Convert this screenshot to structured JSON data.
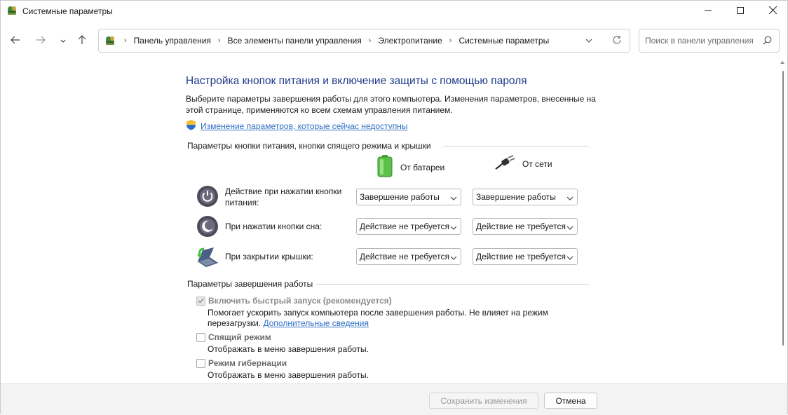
{
  "window": {
    "title": "Системные параметры",
    "icons": {
      "app": "control-panel-icon",
      "minimize": "minimize-icon",
      "maximize": "maximize-icon",
      "close": "close-icon"
    }
  },
  "nav": {
    "breadcrumbs": [
      "Панель управления",
      "Все элементы панели управления",
      "Электропитание",
      "Системные параметры"
    ],
    "search_placeholder": "Поиск в панели управления"
  },
  "page": {
    "title": "Настройка кнопок питания и включение защиты с помощью пароля",
    "description": "Выберите параметры завершения работы для этого компьютера. Изменения параметров, внесенные на этой странице, применяются ко всем схемам управления питанием.",
    "admin_link": "Изменение параметров, которые сейчас недоступны"
  },
  "power_buttons": {
    "header": "Параметры кнопки питания, кнопки спящего режима и крышки",
    "col_battery": "От батареи",
    "col_ac": "От сети",
    "rows": [
      {
        "label": "Действие при нажатии кнопки питания:",
        "battery": "Завершение работы",
        "ac": "Завершение работы"
      },
      {
        "label": "При нажатии кнопки сна:",
        "battery": "Действие не требуется",
        "ac": "Действие не требуется"
      },
      {
        "label": "При закрытии крышки:",
        "battery": "Действие не требуется",
        "ac": "Действие не требуется"
      }
    ]
  },
  "shutdown": {
    "header": "Параметры завершения работы",
    "fast_startup": {
      "label": "Включить быстрый запуск (рекомендуется)",
      "checked": true,
      "desc": "Помогает ускорить запуск компьютера после завершения работы. Не влияет на режим перезагрузки.",
      "link": "Дополнительные сведения"
    },
    "sleep": {
      "label": "Спящий режим",
      "checked": false,
      "desc": "Отображать в меню завершения работы."
    },
    "hibernate": {
      "label": "Режим гибернации",
      "checked": false,
      "desc": "Отображать в меню завершения работы."
    }
  },
  "footer": {
    "save": "Сохранить изменения",
    "cancel": "Отмена"
  },
  "colors": {
    "title": "#1f3b8a",
    "link": "#2f6fc4"
  }
}
